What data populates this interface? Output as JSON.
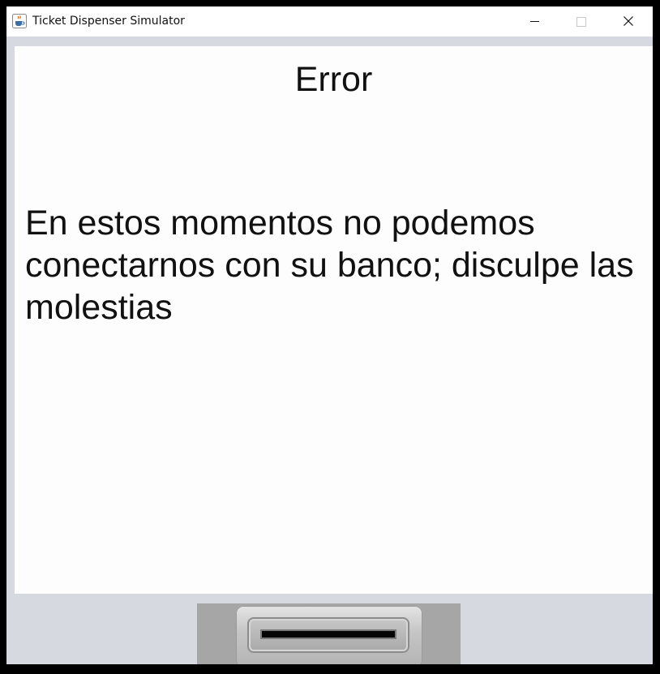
{
  "window": {
    "title": "Ticket Dispenser Simulator",
    "icon": "java-cup-icon",
    "controls": [
      "minimize-icon",
      "maximize-icon",
      "close-icon"
    ]
  },
  "screen": {
    "title": "Error",
    "message": "En estos momentos no podemos conectarnos con su banco; disculpe las molestias"
  },
  "card_slot": {
    "icon": "card-slot"
  },
  "colors": {
    "window_background": "#d6d9df",
    "screen_background": "#fefdfd",
    "slot_panel": "#a6a6a6",
    "slot_opening": "#050505"
  }
}
